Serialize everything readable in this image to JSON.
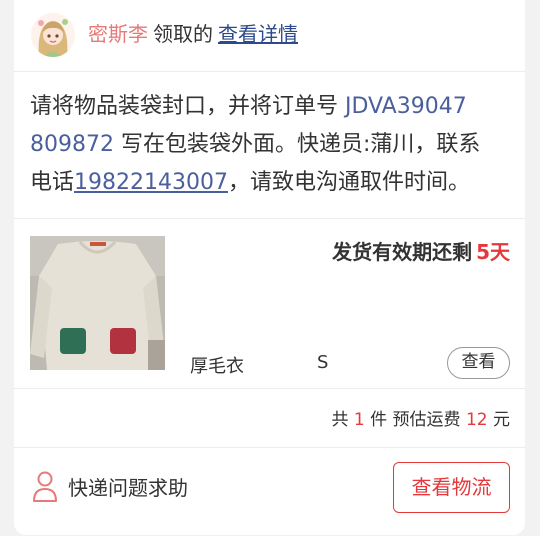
{
  "header": {
    "username": "密斯李",
    "claim_text": "领取的",
    "detail_link": "查看详情"
  },
  "message": {
    "line1_prefix": "请将物品装袋封口，并将订单号 ",
    "order_no_part1": "JDVA39047",
    "order_no_part2": "809872",
    "line2_suffix": " 写在包装袋外面。快递员:蒲川，联系",
    "phone_prefix": "电话",
    "phone": "19822143007",
    "line3_suffix": "，请致电沟通取件时间。"
  },
  "product": {
    "deadline_label": "发货有效期还剩",
    "deadline_days": "5天",
    "name": "厚毛衣",
    "size": "S",
    "view_button": "查看"
  },
  "totals": {
    "prefix": "共",
    "count": "1",
    "unit_label": "件 预估运费",
    "fee": "12",
    "currency": "元"
  },
  "footer": {
    "help_label": "快递问题求助",
    "logistics_button": "查看物流"
  },
  "colors": {
    "accent_red": "#e4393c",
    "link_blue": "#4a5f9c",
    "username_pink": "#e77a78"
  },
  "icons": {
    "avatar": "anime-girl-avatar",
    "help": "person-icon"
  }
}
